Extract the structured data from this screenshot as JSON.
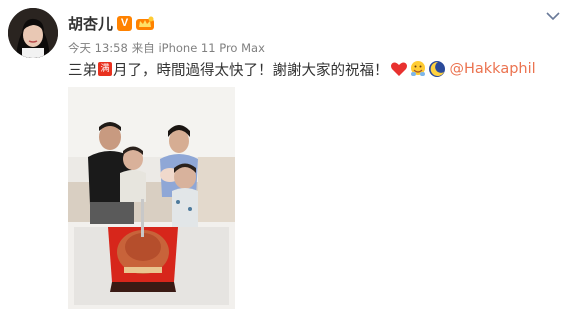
{
  "user": {
    "name": "胡杏儿",
    "verified_badge": "V",
    "level_icon": "vip-crown-icon"
  },
  "meta": {
    "time": "今天 13:58",
    "source": "来自 iPhone 11 Pro Max"
  },
  "post": {
    "text_before": "三弟",
    "full_badge": "满",
    "text_after": "月了，時間過得太快了！謝謝大家的祝福！",
    "emojis": [
      "heart-emoji",
      "hug-emoji",
      "moon-emoji"
    ],
    "mention": "@Hakkaphil"
  },
  "colors": {
    "accent": "#ff8200",
    "mention": "#eb7350",
    "badge_red": "#e8311f",
    "meta_gray": "#808080"
  }
}
